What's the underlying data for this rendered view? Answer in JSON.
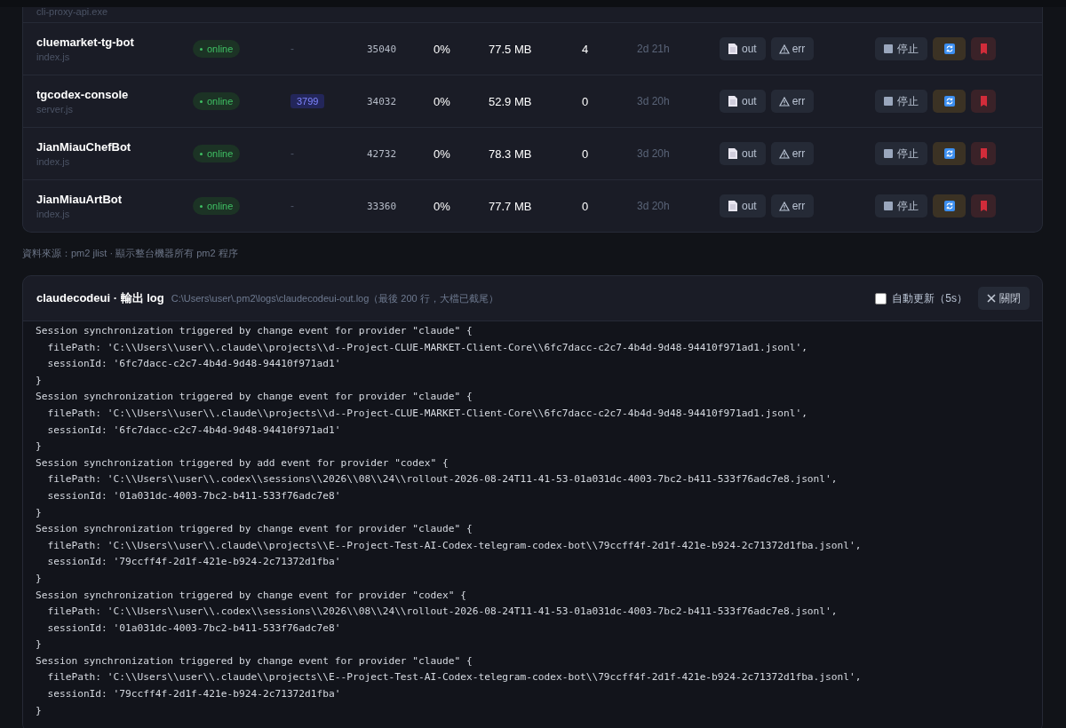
{
  "processes": {
    "partial_row": {
      "script": "cli-proxy-api.exe"
    },
    "rows": [
      {
        "name": "cluemarket-tg-bot",
        "script": "index.js",
        "status": "online",
        "port": {
          "kind": "plain",
          "text": "-"
        },
        "pid": "35040",
        "cpu": "0%",
        "memory": "77.5 MB",
        "restarts": "4",
        "uptime": "2d 21h",
        "out": "out",
        "err": "err",
        "stop": "停止"
      },
      {
        "name": "tgcodex-console",
        "script": "server.js",
        "status": "online",
        "port": {
          "kind": "badge",
          "text": "3799"
        },
        "pid": "34032",
        "cpu": "0%",
        "memory": "52.9 MB",
        "restarts": "0",
        "uptime": "3d 20h",
        "out": "out",
        "err": "err",
        "stop": "停止"
      },
      {
        "name": "JianMiauChefBot",
        "script": "index.js",
        "status": "online",
        "port": {
          "kind": "plain",
          "text": "-"
        },
        "pid": "42732",
        "cpu": "0%",
        "memory": "78.3 MB",
        "restarts": "0",
        "uptime": "3d 20h",
        "out": "out",
        "err": "err",
        "stop": "停止"
      },
      {
        "name": "JianMiauArtBot",
        "script": "index.js",
        "status": "online",
        "port": {
          "kind": "plain",
          "text": "-"
        },
        "pid": "33360",
        "cpu": "0%",
        "memory": "77.7 MB",
        "restarts": "0",
        "uptime": "3d 20h",
        "out": "out",
        "err": "err",
        "stop": "停止"
      }
    ]
  },
  "source_note": "資料來源：pm2 jlist · 顯示整台機器所有 pm2 程序",
  "log_panel": {
    "title": "claudecodeui · 輸出 log",
    "path": "C:\\Users\\user\\.pm2\\logs\\claudecodeui-out.log（最後 200 行，大檔已截尾）",
    "auto_refresh": {
      "label": "自動更新（5s）",
      "checked": false
    },
    "close_button": "關閉",
    "lines": [
      "Session synchronization triggered by change event for provider \"claude\" {",
      "  filePath: 'C:\\\\Users\\\\user\\\\.claude\\\\projects\\\\d--Project-CLUE-MARKET-Client-Core\\\\6fc7dacc-c2c7-4b4d-9d48-94410f971ad1.jsonl',",
      "  sessionId: '6fc7dacc-c2c7-4b4d-9d48-94410f971ad1'",
      "}",
      "Session synchronization triggered by change event for provider \"claude\" {",
      "  filePath: 'C:\\\\Users\\\\user\\\\.claude\\\\projects\\\\d--Project-CLUE-MARKET-Client-Core\\\\6fc7dacc-c2c7-4b4d-9d48-94410f971ad1.jsonl',",
      "  sessionId: '6fc7dacc-c2c7-4b4d-9d48-94410f971ad1'",
      "}",
      "Session synchronization triggered by add event for provider \"codex\" {",
      "  filePath: 'C:\\\\Users\\\\user\\\\.codex\\\\sessions\\\\2026\\\\08\\\\24\\\\rollout-2026-08-24T11-41-53-01a031dc-4003-7bc2-b411-533f76adc7e8.jsonl',",
      "  sessionId: '01a031dc-4003-7bc2-b411-533f76adc7e8'",
      "}",
      "Session synchronization triggered by change event for provider \"claude\" {",
      "  filePath: 'C:\\\\Users\\\\user\\\\.claude\\\\projects\\\\E--Project-Test-AI-Codex-telegram-codex-bot\\\\79ccff4f-2d1f-421e-b924-2c71372d1fba.jsonl',",
      "  sessionId: '79ccff4f-2d1f-421e-b924-2c71372d1fba'",
      "}",
      "Session synchronization triggered by change event for provider \"codex\" {",
      "  filePath: 'C:\\\\Users\\\\user\\\\.codex\\\\sessions\\\\2026\\\\08\\\\24\\\\rollout-2026-08-24T11-41-53-01a031dc-4003-7bc2-b411-533f76adc7e8.jsonl',",
      "  sessionId: '01a031dc-4003-7bc2-b411-533f76adc7e8'",
      "}",
      "Session synchronization triggered by change event for provider \"claude\" {",
      "  filePath: 'C:\\\\Users\\\\user\\\\.claude\\\\projects\\\\E--Project-Test-AI-Codex-telegram-codex-bot\\\\79ccff4f-2d1f-421e-b924-2c71372d1fba.jsonl',",
      "  sessionId: '79ccff4f-2d1f-421e-b924-2c71372d1fba'",
      "}"
    ]
  }
}
